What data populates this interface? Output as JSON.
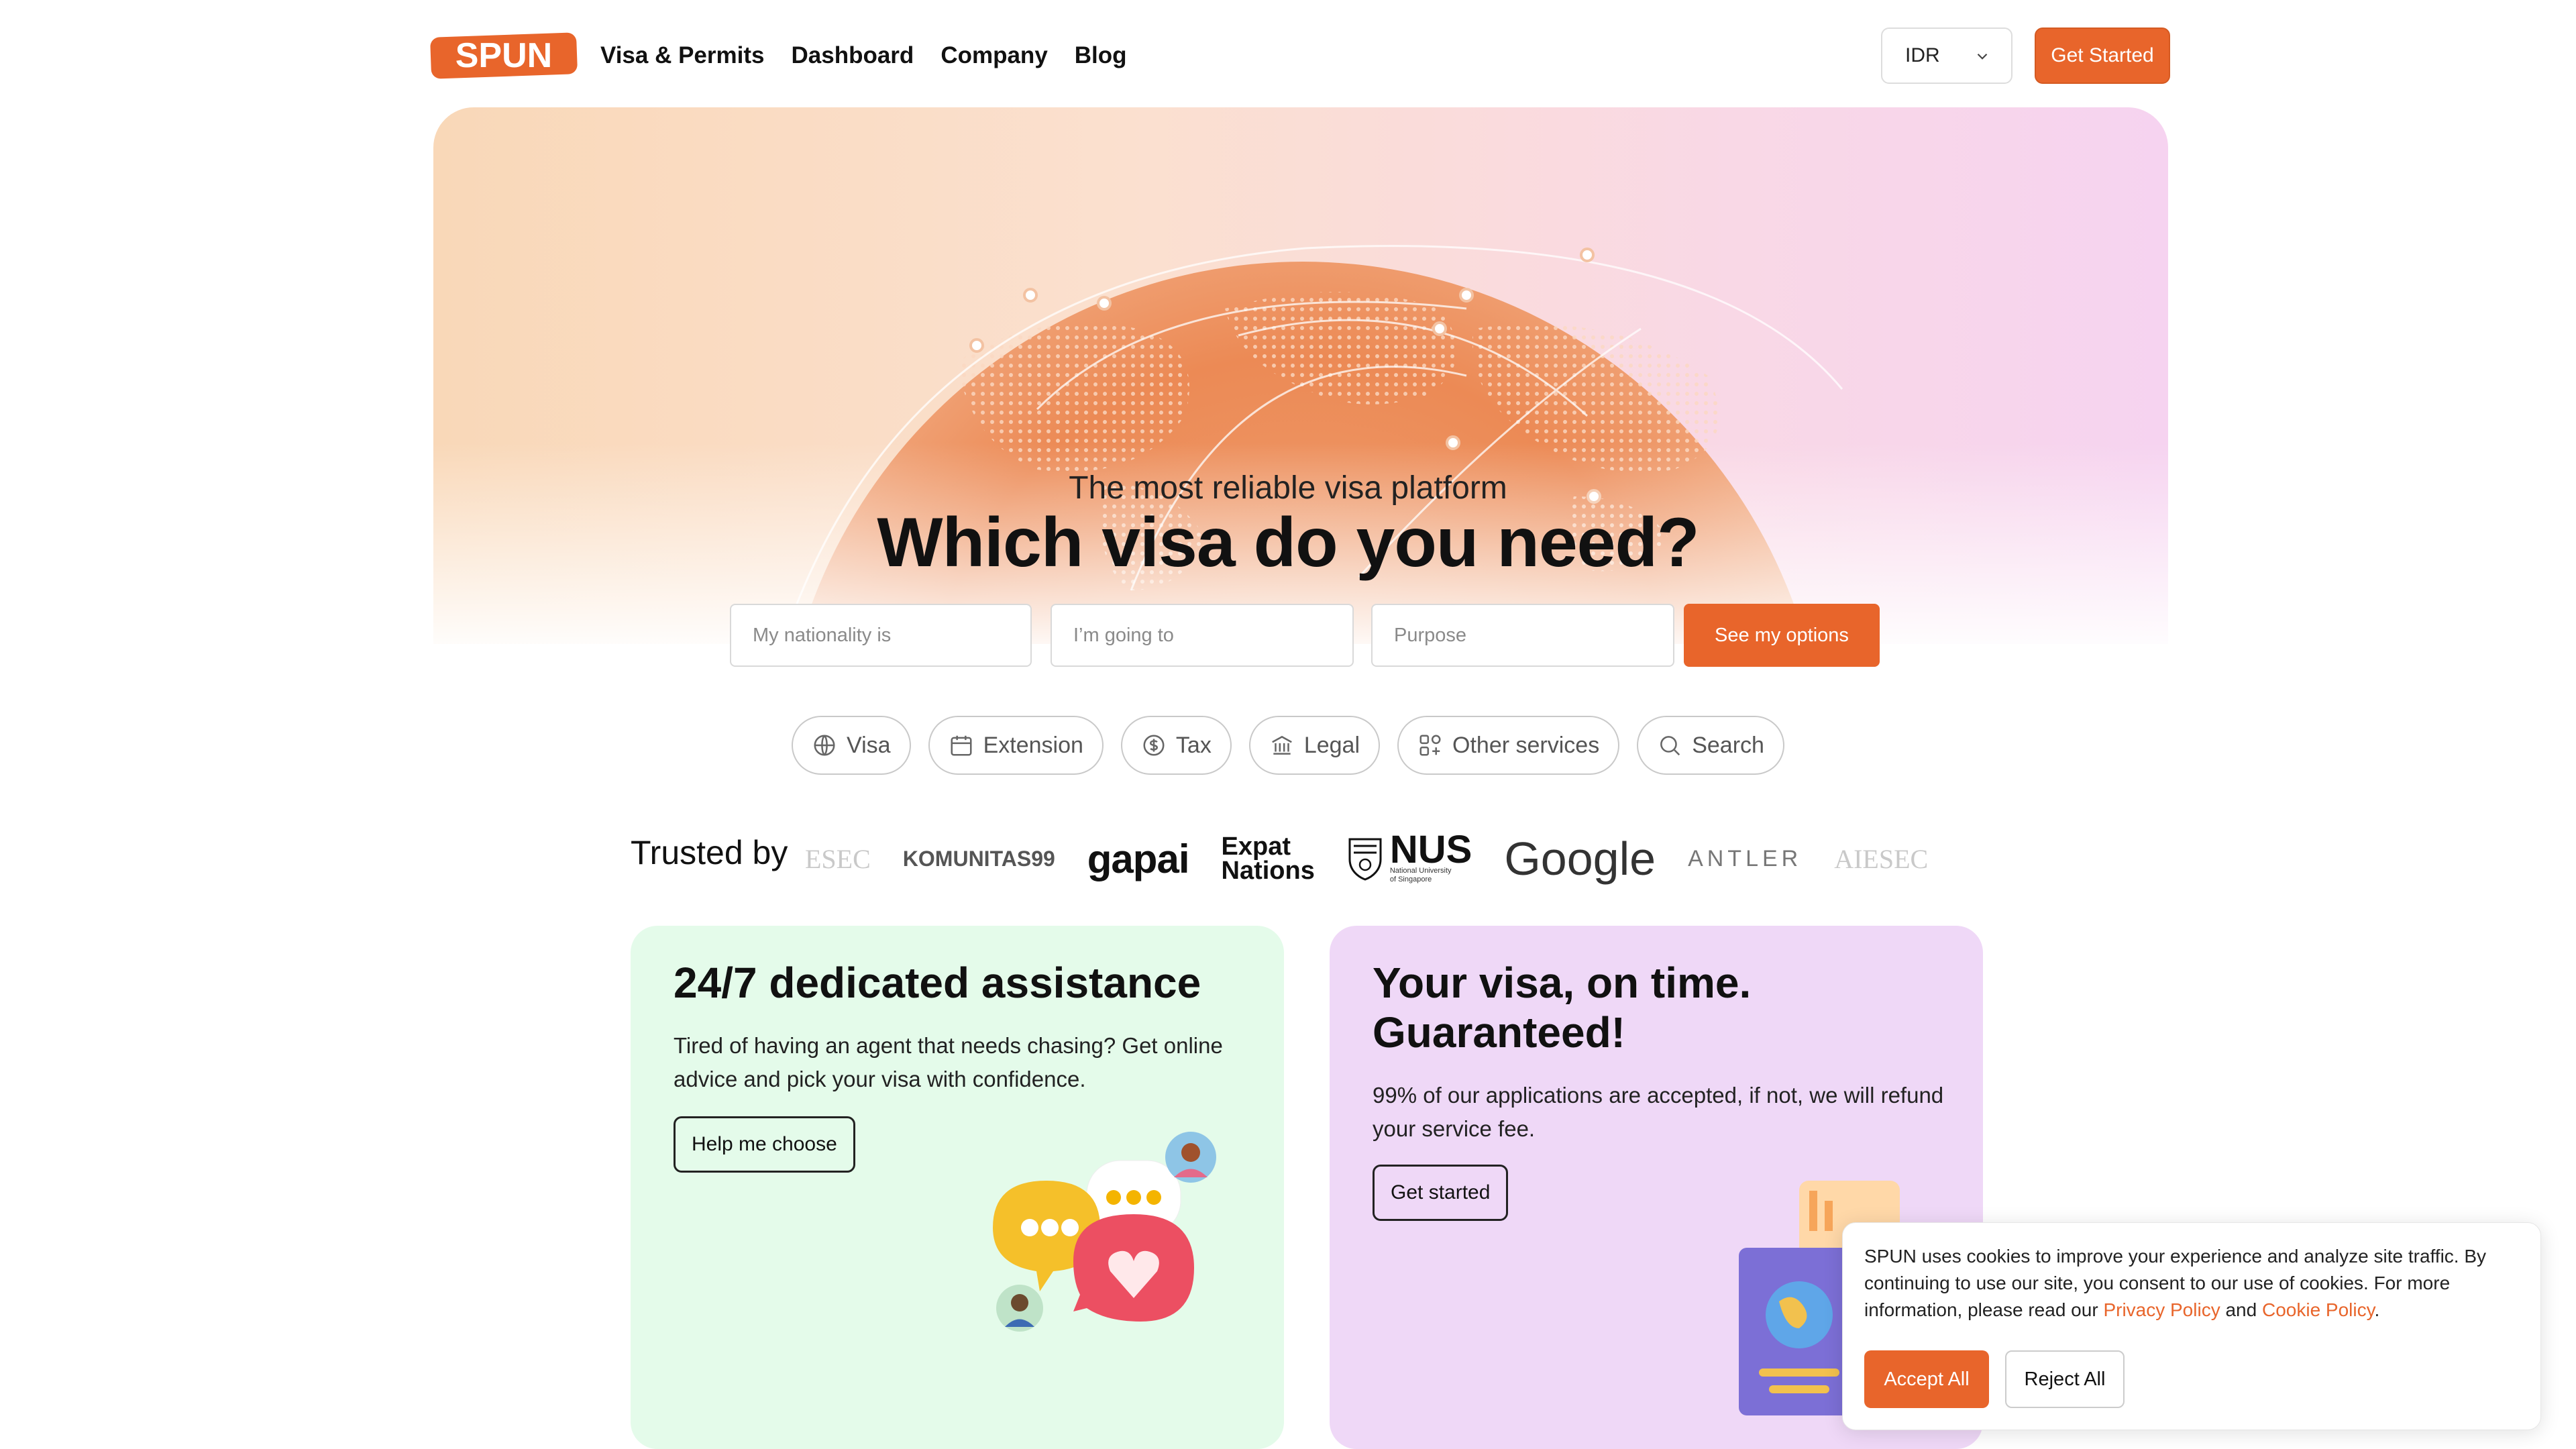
{
  "nav": {
    "logo_text": "SPUN",
    "links": [
      "Visa & Permits",
      "Dashboard",
      "Company",
      "Blog"
    ],
    "currency": "IDR",
    "cta": "Get Started"
  },
  "hero": {
    "subtitle": "The most reliable visa platform",
    "title": "Which visa do you need?",
    "fields": {
      "nationality_placeholder": "My nationality is",
      "destination_placeholder": "I’m going to",
      "purpose_placeholder": "Purpose"
    },
    "submit": "See my options"
  },
  "services": {
    "pills": [
      {
        "label": "Visa",
        "icon": "globe-icon"
      },
      {
        "label": "Extension",
        "icon": "calendar-icon"
      },
      {
        "label": "Tax",
        "icon": "dollar-icon"
      },
      {
        "label": "Legal",
        "icon": "bank-icon"
      },
      {
        "label": "Other services",
        "icon": "grid-icon"
      },
      {
        "label": "Search",
        "icon": "search-icon"
      }
    ]
  },
  "trusted": {
    "label": "Trusted by",
    "logos": {
      "left_faded": "ESEC",
      "komunitas": "KOMUNITAS99",
      "gapai": "gapai",
      "expat_line1": "Expat",
      "expat_line2": "Nations",
      "nus": "NUS",
      "nus_sub1": "National University",
      "nus_sub2": "of Singapore",
      "google": "Google",
      "antler": "ANTLER",
      "right_faded": "AIESEC"
    }
  },
  "cards": {
    "assistance": {
      "title": "24/7 dedicated assistance",
      "text": "Tired of having an agent that needs chasing? Get online advice and pick your visa with confidence.",
      "button": "Help me choose"
    },
    "guarantee": {
      "title_line1": "Your visa, on time.",
      "title_line2": "Guaranteed!",
      "text": "99% of our applications are accepted, if not, we will refund your service fee.",
      "button": "Get started"
    }
  },
  "cookie": {
    "text_before": "SPUN uses cookies to improve your experience and analyze site traffic. By continuing to use our site, you consent to our use of cookies. For more information, please read our ",
    "privacy_link": "Privacy Policy",
    "and": " and ",
    "cookie_link": "Cookie Policy",
    "period": ".",
    "accept": "Accept All",
    "reject": "Reject All"
  },
  "colors": {
    "brand": "#e8652b",
    "card_green": "#e4fbea",
    "card_purple": "#efd8f7"
  }
}
